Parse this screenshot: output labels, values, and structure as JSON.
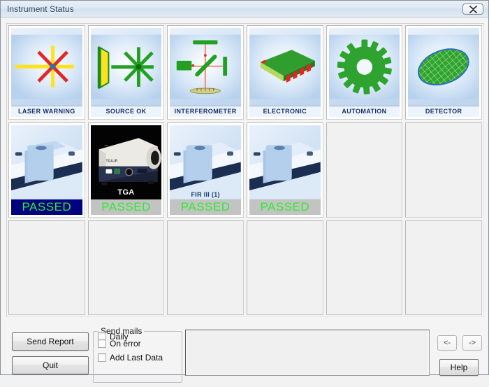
{
  "window": {
    "title": "Instrument Status",
    "close_label": "Close",
    "close_icon": "close-x-icon"
  },
  "grid": {
    "columns": 6,
    "rows": 3,
    "status_row": [
      {
        "label": "",
        "overlabel": "",
        "status": "PASSED",
        "selected": true,
        "image": "spectrometer-photo",
        "status_color": "#2bee2b",
        "status_bg": "#000080"
      },
      {
        "label": "",
        "overlabel": "TGA",
        "status": "PASSED",
        "selected": false,
        "image": "tga-instrument-photo",
        "status_color": "#2bee2b",
        "status_bg": "#c3c3c3"
      },
      {
        "label": "",
        "overlabel": "FIR III (1)",
        "status": "PASSED",
        "selected": false,
        "image": "spectrometer-photo",
        "status_color": "#2bee2b",
        "status_bg": "#c3c3c3"
      },
      {
        "label": "",
        "overlabel": "",
        "status": "PASSED",
        "selected": false,
        "image": "spectrometer-photo",
        "status_color": "#2bee2b",
        "status_bg": "#c3c3c3"
      },
      {
        "empty": true
      },
      {
        "empty": true
      }
    ],
    "icon_row": [
      {
        "label": "LASER WARNING",
        "icon": "laser-beam-starburst-icon"
      },
      {
        "label": "SOURCE OK",
        "icon": "source-aperture-starburst-icon"
      },
      {
        "label": "INTERFEROMETER",
        "icon": "michelson-interferometer-icon"
      },
      {
        "label": "ELECTRONIC",
        "icon": "circuit-board-icon"
      },
      {
        "label": "AUTOMATION",
        "icon": "gear-icon"
      },
      {
        "label": "DETECTOR",
        "icon": "mesh-ellipse-detector-icon"
      }
    ],
    "empty_row": [
      {
        "empty": true
      },
      {
        "empty": true
      },
      {
        "empty": true
      },
      {
        "empty": true
      },
      {
        "empty": true
      },
      {
        "empty": true
      }
    ]
  },
  "bottom": {
    "send_report_label": "Send Report",
    "quit_label": "Quit",
    "help_label": "Help",
    "prev_label": "<-",
    "next_label": "->",
    "log_value": "",
    "group": {
      "legend": "Send mails",
      "items": [
        {
          "label": "Daily",
          "checked": false
        },
        {
          "label": "On error",
          "checked": false
        },
        {
          "label": "Add Last Data",
          "checked": false
        }
      ]
    }
  },
  "colors": {
    "accent_green": "#2bb32b",
    "selected_blue": "#000080",
    "caption_text": "#16306b",
    "titlebar_text": "#1d3f63"
  }
}
